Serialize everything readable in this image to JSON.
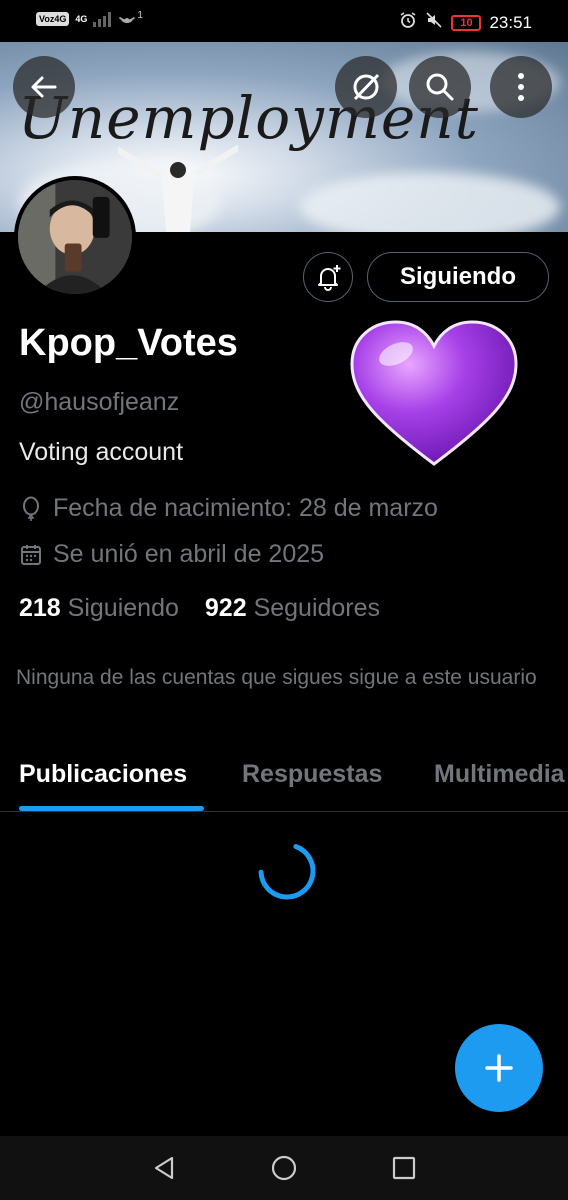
{
  "status_bar": {
    "carrier_badge": "Voz4G",
    "network_generation": "4G",
    "hotspot_count": "1",
    "battery_level": "10",
    "time": "23:51"
  },
  "banner": {
    "title": "Unemployment"
  },
  "profile": {
    "name": "Kpop_Votes",
    "handle": "@hausofjeanz",
    "bio": "Voting account",
    "birthday": "Fecha de nacimiento: 28 de marzo",
    "joined": "Se unió en abril de 2025",
    "following_count": "218",
    "following_label": "Siguiendo",
    "followers_count": "922",
    "followers_label": "Seguidores",
    "mutuals_note": "Ninguna de las cuentas que sigues sigue a este usuario"
  },
  "actions": {
    "follow_button": "Siguiendo"
  },
  "tabs": [
    {
      "label": "Publicaciones",
      "active": true
    },
    {
      "label": "Respuestas",
      "active": false
    },
    {
      "label": "Multimedia",
      "active": false
    }
  ],
  "icons": {
    "back": "arrow-left-icon",
    "grok": "grok-icon",
    "search": "search-icon",
    "more": "more-vertical-icon",
    "notify": "bell-plus-icon",
    "birthday": "balloon-icon",
    "calendar": "calendar-icon",
    "compose": "plus-icon",
    "nav_back": "triangle-back-icon",
    "nav_home": "circle-home-icon",
    "nav_recent": "square-recent-icon"
  },
  "colors": {
    "accent": "#1d9bf0",
    "background": "#000000",
    "secondary_text": "#71767b",
    "battery_low": "#ee3333"
  }
}
